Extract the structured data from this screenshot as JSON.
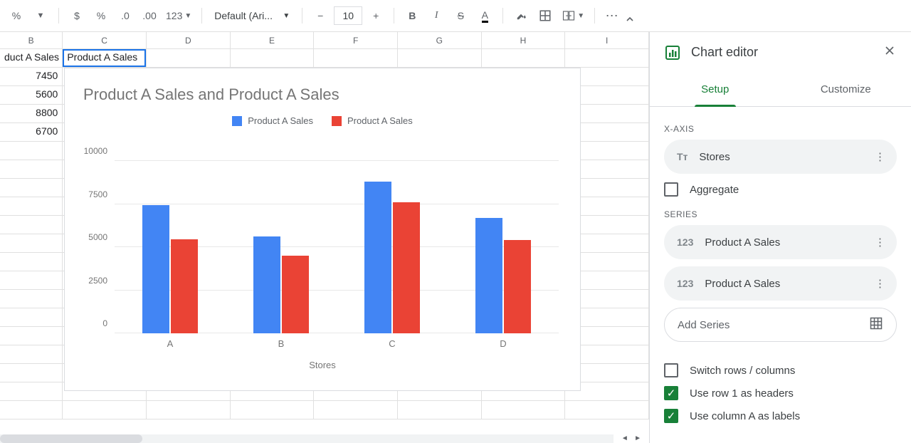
{
  "toolbar": {
    "percent_icon": "%",
    "dollar_icon": "$",
    "dec_dec": ".0",
    "dec_inc": ".00",
    "num_format": "123",
    "font_name": "Default (Ari...",
    "font_size": "10",
    "bold": "B",
    "italic": "I",
    "strike": "S",
    "text_color": "A",
    "more": "⋯"
  },
  "columns": [
    "B",
    "C",
    "D",
    "E",
    "F",
    "G",
    "H",
    "I"
  ],
  "sheet": {
    "b1": "duct A Sales",
    "c1": "Product A Sales",
    "b2": "7450",
    "b3": "5600",
    "b4": "8800",
    "b5": "6700"
  },
  "chart_data": {
    "type": "bar",
    "title": "Product A Sales and Product A Sales",
    "xlabel": "Stores",
    "ylabel": "",
    "ylim": [
      0,
      10000
    ],
    "yticks": [
      0,
      2500,
      5000,
      7500,
      10000
    ],
    "categories": [
      "A",
      "B",
      "C",
      "D"
    ],
    "series": [
      {
        "name": "Product A Sales",
        "color": "#4285f4",
        "values": [
          7450,
          5600,
          8800,
          6700
        ]
      },
      {
        "name": "Product A Sales",
        "color": "#ea4335",
        "values": [
          5450,
          4500,
          7600,
          5400
        ]
      }
    ]
  },
  "side_panel": {
    "title": "Chart editor",
    "tab_setup": "Setup",
    "tab_customize": "Customize",
    "xaxis_label": "X-AXIS",
    "xaxis_field": "Stores",
    "aggregate": "Aggregate",
    "series_label": "SERIES",
    "series1": "Product A Sales",
    "series2": "Product A Sales",
    "add_series": "Add Series",
    "switch_rows": "Switch rows / columns",
    "row1_headers": "Use row 1 as headers",
    "colA_labels": "Use column A as labels"
  }
}
